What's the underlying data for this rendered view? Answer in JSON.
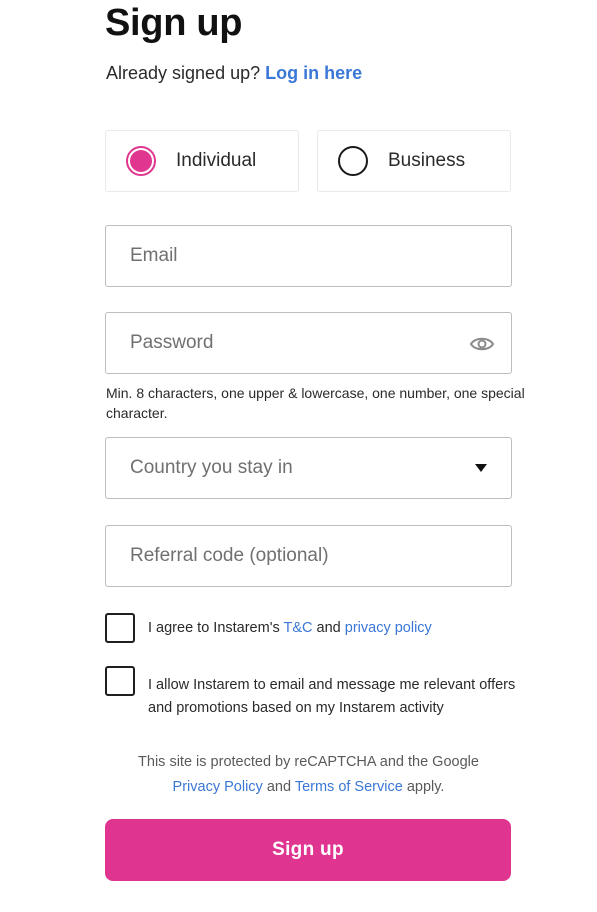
{
  "header": {
    "title": "Sign up",
    "login_prompt": "Already signed up?",
    "login_link": "Log in here"
  },
  "account_type": {
    "selected": "Individual",
    "options": [
      {
        "label": "Individual"
      },
      {
        "label": "Business"
      }
    ]
  },
  "form": {
    "email_placeholder": "Email",
    "password_placeholder": "Password",
    "password_hint": "Min. 8 characters, one upper & lowercase, one number, one special character.",
    "country_placeholder": "Country you stay in",
    "referral_placeholder": "Referral code (optional)"
  },
  "consents": {
    "tc_prefix": "I agree to Instarem's",
    "tc_link": "T&C",
    "tc_and": "and",
    "privacy_link": "privacy policy",
    "marketing_text": "I allow Instarem to email and message me relevant offers and promotions based on my Instarem activity"
  },
  "recaptcha": {
    "line1": "This site is protected by reCAPTCHA and the Google",
    "privacy_link": "Privacy Policy",
    "and": "and",
    "terms_link": "Terms of Service",
    "apply": "apply."
  },
  "submit_label": "Sign up",
  "colors": {
    "accent": "#df3590",
    "link": "#3b77d6",
    "border": "#bdbdbd"
  },
  "icons": {
    "password_toggle": "eye-icon",
    "country_dropdown": "caret-down-icon"
  }
}
